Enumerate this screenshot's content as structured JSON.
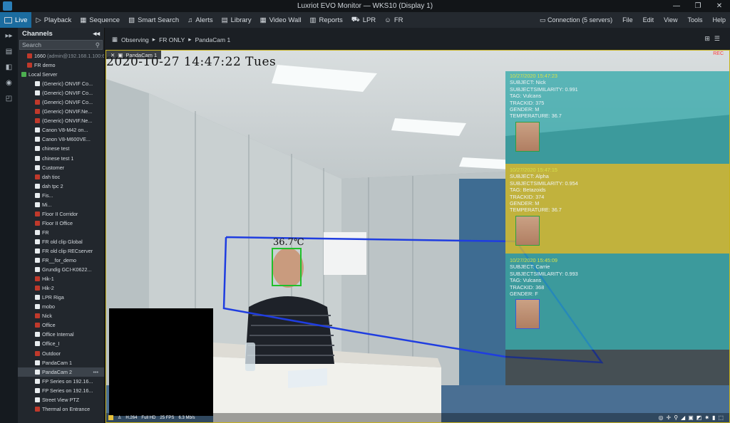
{
  "window": {
    "title": "Luxriot EVO Monitor — WKS10 (Display 1)",
    "minimize": "—",
    "maximize": "❐",
    "close": "✕"
  },
  "menu": {
    "tabs": [
      {
        "label": "Live",
        "icon": "monitor-icon"
      },
      {
        "label": "Playback",
        "icon": "play-icon"
      },
      {
        "label": "Sequence",
        "icon": "sequence-icon"
      },
      {
        "label": "Smart Search",
        "icon": "smart-search-icon"
      },
      {
        "label": "Alerts",
        "icon": "bell-icon"
      },
      {
        "label": "Library",
        "icon": "library-icon"
      },
      {
        "label": "Video Wall",
        "icon": "video-wall-icon"
      },
      {
        "label": "Reports",
        "icon": "reports-icon"
      },
      {
        "label": "LPR",
        "icon": "car-icon"
      },
      {
        "label": "FR",
        "icon": "face-icon"
      }
    ],
    "connection": "Connection (5 servers)",
    "file": "File",
    "edit": "Edit",
    "view": "View",
    "tools": "Tools",
    "help": "Help"
  },
  "channels": {
    "title": "Channels",
    "search_placeholder": "Search",
    "items": [
      {
        "label": "1660",
        "extra": "(admin@192.168.1.100:60...",
        "kind": "red",
        "level": 1
      },
      {
        "label": "FR demo",
        "kind": "red",
        "level": 1
      },
      {
        "label": "Local Server",
        "kind": "green",
        "level": 0
      },
      {
        "label": "(Generic) ONVIF Co...",
        "kind": "white",
        "level": 2
      },
      {
        "label": "(Generic) ONVIF Co...",
        "kind": "white",
        "level": 2
      },
      {
        "label": "(Generic) ONVIF Co...",
        "kind": "red",
        "level": 2
      },
      {
        "label": "(Generic) ONVIF.Ne...",
        "kind": "red",
        "level": 2
      },
      {
        "label": "(Generic) ONVIF.Ne...",
        "kind": "red",
        "level": 2
      },
      {
        "label": "Canon V8-M42 on...",
        "kind": "white",
        "level": 2
      },
      {
        "label": "Canon V8-M600VE...",
        "kind": "white",
        "level": 2
      },
      {
        "label": "chinese test",
        "kind": "white",
        "level": 2
      },
      {
        "label": "chinese test 1",
        "kind": "white",
        "level": 2
      },
      {
        "label": "Customer",
        "kind": "white",
        "level": 2
      },
      {
        "label": "dah tioc",
        "kind": "red",
        "level": 2
      },
      {
        "label": "dah tpc 2",
        "kind": "white",
        "level": 2
      },
      {
        "label": "Fis...",
        "kind": "white",
        "level": 2
      },
      {
        "label": "Mi...",
        "kind": "white",
        "level": 2
      },
      {
        "label": "Floor II Corridor",
        "kind": "red",
        "level": 2
      },
      {
        "label": "Floor II Office",
        "kind": "red",
        "level": 2
      },
      {
        "label": "FR",
        "kind": "white",
        "level": 2
      },
      {
        "label": "FR old clip Global",
        "kind": "white",
        "level": 2
      },
      {
        "label": "FR old clip RECserver",
        "kind": "white",
        "level": 2
      },
      {
        "label": "FR__for_demo",
        "kind": "white",
        "level": 2
      },
      {
        "label": "Grundig GCI-K0622...",
        "kind": "white",
        "level": 2
      },
      {
        "label": "Hik-1",
        "kind": "red",
        "level": 2
      },
      {
        "label": "Hik-2",
        "kind": "red",
        "level": 2
      },
      {
        "label": "LPR Riga",
        "kind": "white",
        "level": 2
      },
      {
        "label": "mobo",
        "kind": "white",
        "level": 2
      },
      {
        "label": "Nick",
        "kind": "red",
        "level": 2
      },
      {
        "label": "Office",
        "kind": "red",
        "level": 2
      },
      {
        "label": "Office Internal",
        "kind": "white",
        "level": 2
      },
      {
        "label": "Office_I",
        "kind": "white",
        "level": 2
      },
      {
        "label": "Outdoor",
        "kind": "red",
        "level": 2
      },
      {
        "label": "PandaCam 1",
        "kind": "white",
        "level": 2
      },
      {
        "label": "PandaCam 2",
        "kind": "white",
        "level": 2,
        "selected": true,
        "more": "•••"
      },
      {
        "label": "FP Series on 192.16...",
        "kind": "white",
        "level": 2
      },
      {
        "label": "FP Series on 192.16...",
        "kind": "white",
        "level": 2
      },
      {
        "label": "Street View PTZ",
        "kind": "white",
        "level": 2
      },
      {
        "label": "Thermal on Entrance",
        "kind": "red",
        "level": 2
      }
    ]
  },
  "breadcrumb": {
    "parts": [
      "Observing",
      "FR ONLY",
      "PandaCam 1"
    ]
  },
  "camera": {
    "tab_label": "PandaCam 1",
    "osd_timestamp": "2020-10-27 14:47:22 Tues",
    "rec_label": "REC",
    "temperature": "36.7℃",
    "status": {
      "codec": "H.264",
      "resolution": "Full HD",
      "fps": "25 FPS",
      "bitrate": "6.3 Mb/s"
    }
  },
  "recognitions": [
    {
      "timestamp": "10/27/2020 15:47:23",
      "lines": [
        "SUBJECT: Nick",
        "SUBJECTSIMILARITY: 0.991",
        "TAG: Vulcans",
        "TRACKID: 375",
        "GENDER: M",
        "TEMPERATURE: 36.7"
      ],
      "color": "#2aa6a8"
    },
    {
      "timestamp": "10/27/2020 15:47:15",
      "lines": [
        "SUBJECT: Alpha",
        "SUBJECTSIMILARITY: 0.954",
        "TAG: Betazoids",
        "TRACKID: 374",
        "GENDER: M",
        "TEMPERATURE: 36.7"
      ],
      "color": "#d8c22a"
    },
    {
      "timestamp": "10/27/2020 15:45:09",
      "lines": [
        "SUBJECT: Carrie",
        "SUBJECTSIMILARITY: 0.993",
        "TAG: Vulcans",
        "TRACKID: 368",
        "GENDER: F"
      ],
      "color": "#2aa6a8"
    }
  ]
}
